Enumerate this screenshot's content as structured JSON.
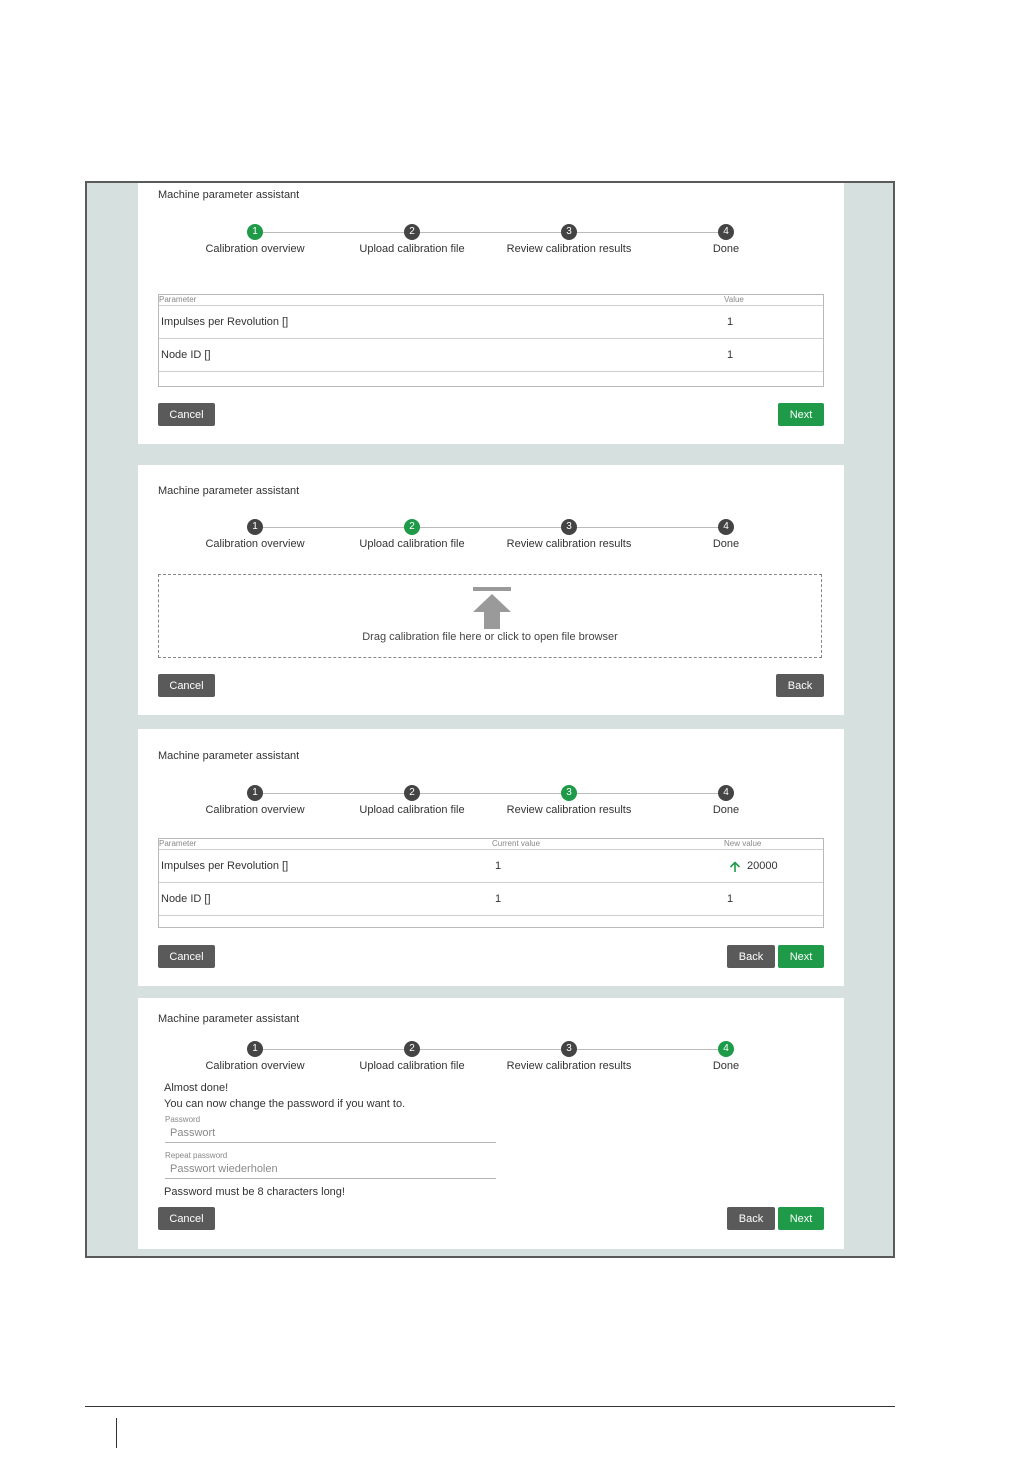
{
  "wizard": {
    "title": "Machine parameter assistant",
    "steps": [
      {
        "number": "1",
        "label": "Calibration overview"
      },
      {
        "number": "2",
        "label": "Upload calibration file"
      },
      {
        "number": "3",
        "label": "Review calibration results"
      },
      {
        "number": "4",
        "label": "Done"
      }
    ],
    "buttons": {
      "cancel": "Cancel",
      "next": "Next",
      "back": "Back"
    },
    "colors": {
      "accent": "#1e9a48",
      "step_inactive": "#444444",
      "button_gray": "#5a5a5a"
    }
  },
  "panel1": {
    "active_step": 1,
    "table": {
      "headers": [
        "Parameter",
        "Value"
      ],
      "rows": [
        {
          "parameter": "Impulses per Revolution []",
          "value": "1"
        },
        {
          "parameter": "Node ID []",
          "value": "1"
        }
      ]
    }
  },
  "panel2": {
    "active_step": 2,
    "dropzone": {
      "text": "Drag calibration file here or click to open file browser",
      "icon": "upload-arrow-icon"
    }
  },
  "panel3": {
    "active_step": 3,
    "table": {
      "headers": [
        "Parameter",
        "Current value",
        "New value"
      ],
      "rows": [
        {
          "parameter": "Impulses per Revolution []",
          "current": "1",
          "new": "20000",
          "new_icon": "arrow-up-icon"
        },
        {
          "parameter": "Node ID []",
          "current": "1",
          "new": "1"
        }
      ]
    }
  },
  "panel4": {
    "active_step": 4,
    "almost_done": "Almost done!",
    "change_text": "You can now change the password if you want to.",
    "password_label": "Password",
    "password_placeholder": "Passwort",
    "repeat_label": "Repeat password",
    "repeat_placeholder": "Passwort wiederholen",
    "validation": "Password must be 8 characters long!"
  }
}
